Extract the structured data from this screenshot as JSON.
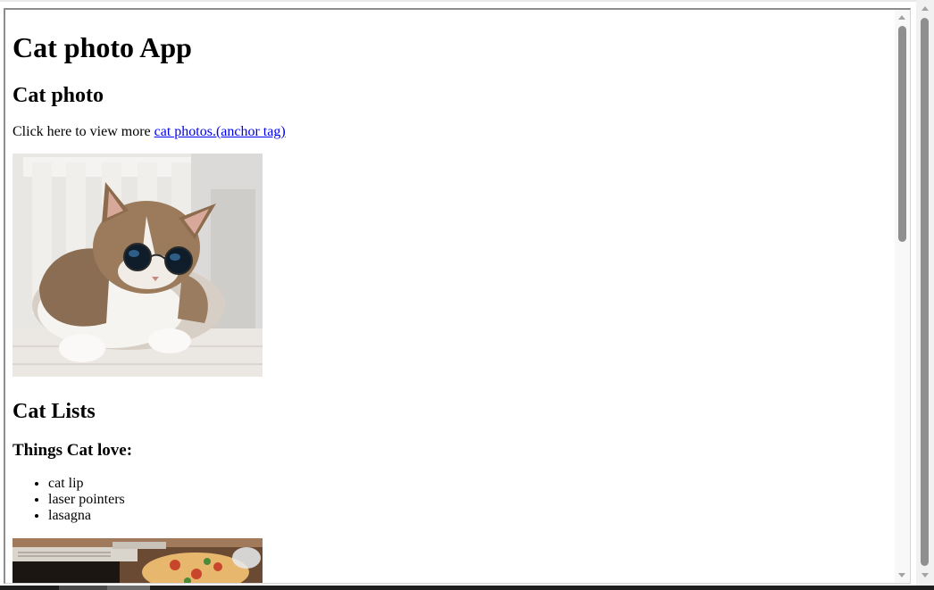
{
  "page": {
    "title": "Cat photo App",
    "section_photo": {
      "heading": "Cat photo",
      "intro_text": "Click here to view more ",
      "link_text": "cat photos.(anchor tag)"
    },
    "cat_image_label": "cat wearing round sunglasses on a white chair",
    "section_lists": {
      "heading": "Cat Lists",
      "subheading": "Things Cat love:",
      "items": [
        "cat lip",
        "laser pointers",
        "lasagna"
      ]
    },
    "pizza_image_label": "lasagna / pizza on a table"
  },
  "colors": {
    "link": "#0000ee",
    "scroll_thumb": "#8f8f8f",
    "frame_border": "#8d8d8d"
  }
}
